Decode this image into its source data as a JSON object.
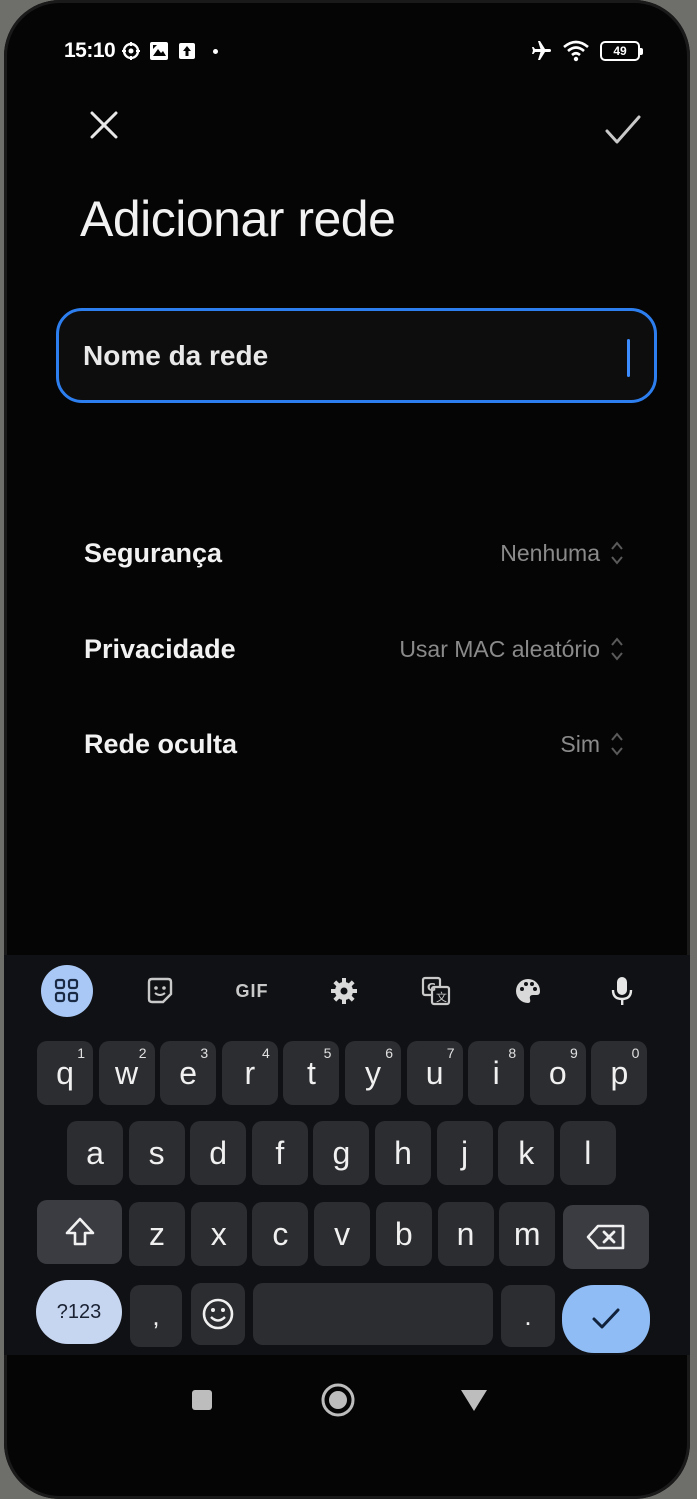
{
  "status_bar": {
    "time": "15:10",
    "battery": "49",
    "icons_left": [
      "sync-gear-icon",
      "photo-icon",
      "upload-icon"
    ],
    "icons_right": [
      "airplane-icon",
      "wifi-icon",
      "battery-icon"
    ]
  },
  "header": {
    "title": "Adicionar rede"
  },
  "network_name_field": {
    "placeholder": "Nome da rede",
    "value": ""
  },
  "settings": [
    {
      "label": "Segurança",
      "value": "Nenhuma"
    },
    {
      "label": "Privacidade",
      "value": "Usar MAC aleatório"
    },
    {
      "label": "Rede oculta",
      "value": "Sim"
    }
  ],
  "keyboard": {
    "toolbar": [
      "apps-icon",
      "sticker-icon",
      "GIF",
      "settings-icon",
      "translate-icon",
      "palette-icon",
      "mic-icon"
    ],
    "gif_label": "GIF",
    "row1": [
      {
        "k": "q",
        "s": "1"
      },
      {
        "k": "w",
        "s": "2"
      },
      {
        "k": "e",
        "s": "3"
      },
      {
        "k": "r",
        "s": "4"
      },
      {
        "k": "t",
        "s": "5"
      },
      {
        "k": "y",
        "s": "6"
      },
      {
        "k": "u",
        "s": "7"
      },
      {
        "k": "i",
        "s": "8"
      },
      {
        "k": "o",
        "s": "9"
      },
      {
        "k": "p",
        "s": "0"
      }
    ],
    "row2": [
      "a",
      "s",
      "d",
      "f",
      "g",
      "h",
      "j",
      "k",
      "l"
    ],
    "row3": [
      "z",
      "x",
      "c",
      "v",
      "b",
      "n",
      "m"
    ],
    "symbols_label": "?123",
    "comma": ",",
    "period": "."
  },
  "colors": {
    "accent": "#2d7ff0",
    "keyboard_accent": "#8fbcf5",
    "background": "#050505"
  }
}
